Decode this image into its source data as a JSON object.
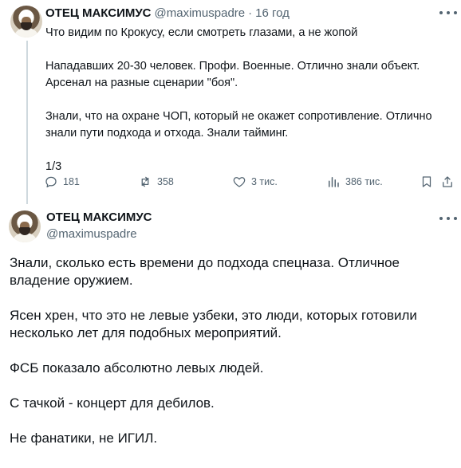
{
  "tweet1": {
    "author_name": "ОТЕЦ МАКСИМУС",
    "handle": "@maximuspadre",
    "separator": "·",
    "time": "16 год",
    "lines": [
      "Что видим по Крокусу, если смотреть глазами, а не жопой",
      "",
      "Нападавших 20-30 человек. Профи. Военные. Отлично знали объект.",
      "Арсенал на разные сценарии \"боя\".",
      "",
      "Знали, что на охране ЧОП, который не окажет сопротивление. Отлично",
      "знали пути подхода и отхода. Знали тайминг.",
      "",
      "1/3"
    ],
    "actions": {
      "replies": "181",
      "reposts": "358",
      "likes": "3 тис.",
      "views": "386 тис."
    }
  },
  "tweet2": {
    "author_name": "ОТЕЦ МАКСИМУС",
    "handle": "@maximuspadre",
    "paragraphs": [
      "Знали, сколько есть времени до подхода спецназа. Отличное владение оружием.",
      "Ясен хрен, что это не левые узбеки, это люди, которых готовили несколько лет для подобных мероприятий.",
      "ФСБ показало абсолютно левых людей.",
      "С тачкой - концерт для дебилов.",
      "Не фанатики, не ИГИЛ."
    ]
  },
  "icons": {
    "reply": "reply-icon",
    "repost": "repost-icon",
    "like": "heart-icon",
    "views": "views-chart-icon",
    "bookmark": "bookmark-icon",
    "share": "share-icon",
    "more": "more-dots-icon"
  },
  "colors": {
    "text": "#0f1419",
    "secondary": "#536471",
    "thread_line": "#cfd9de"
  }
}
